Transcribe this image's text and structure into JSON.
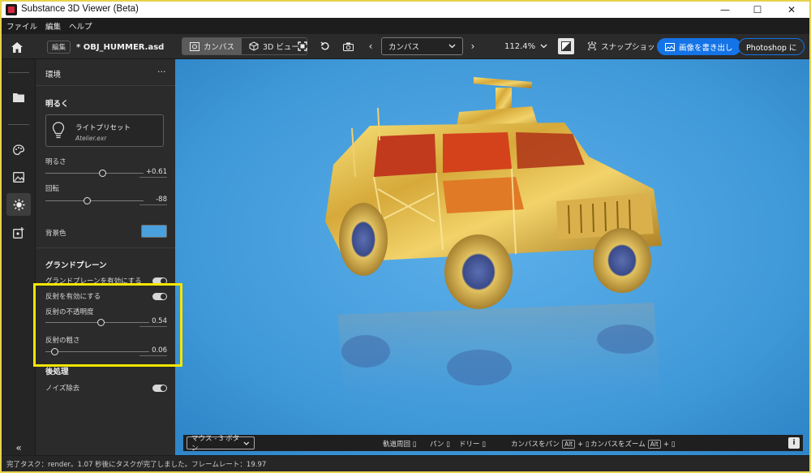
{
  "window": {
    "title": "Substance 3D Viewer (Beta)",
    "minimize": "—",
    "maximize": "☐",
    "close": "✕"
  },
  "menu": [
    "ファイル",
    "編集",
    "ヘルプ"
  ],
  "toolbar": {
    "edit_chip": "編集",
    "doc_name": "* OBJ_HUMMER.asd",
    "canvas_tab": "カンバス",
    "view3d_tab": "3D ビュー",
    "view_select": "カンバス",
    "zoom": "112.4%",
    "snapshot": "スナップショット",
    "export_button": "画像を書き出し",
    "photoshop_button": "Photoshop に"
  },
  "panel": {
    "title": "環境",
    "more": "···",
    "section_brightness": "明るく",
    "preset_label": "ライトプリセット",
    "preset_value": "Atelier.exr",
    "brightness_label": "明るさ",
    "brightness_value": "+0.61",
    "brightness_level": 0.61,
    "rotation_label": "回転",
    "rotation_value": "-88",
    "bg_label": "背景色",
    "bg_color": "#4aa0dc",
    "section_ground": "グランドプレーン",
    "ground_enable": "グランドプレーンを有効にする",
    "reflect_enable": "反射を有効にする",
    "reflect_opacity_label": "反射の不透明度",
    "reflect_opacity_value": "0.54",
    "reflect_rough_label": "反射の粗さ",
    "reflect_rough_value": "0.06",
    "section_post": "後処理",
    "denoise": "ノイズ除去"
  },
  "bottombar": {
    "mouse_mode": "マウス - 3 ボタン",
    "orbit": "軌道周回",
    "pan": "パン",
    "dolly": "ドリー",
    "canvas_pan": "カンバスをパン",
    "canvas_zoom": "カンバスをズーム",
    "alt_key": "Alt",
    "plus": "+"
  },
  "status": "完了タスク：render。1.07 秒後にタスクが完了しました。フレームレート：19.97",
  "colors": {
    "accent": "#1473e6",
    "highlight": "#f7e600",
    "canvas_bg": "#4aa0dc"
  }
}
